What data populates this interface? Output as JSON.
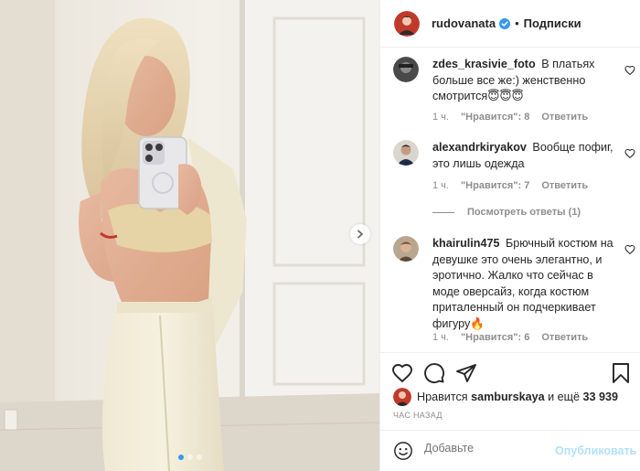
{
  "header": {
    "username": "rudovanata",
    "separator": "•",
    "follow_label": "Подписки"
  },
  "comments": [
    {
      "username": "zdes_krasivie_foto",
      "text": "В платьях больше все же:) женственно смотрится😇😇😇",
      "time": "1 ч.",
      "likes": "\"Нравится\": 8",
      "reply_label": "Ответить",
      "avatar_icon": "avatar-icon"
    },
    {
      "username": "alexandrkiryakov",
      "text": "Вообще пофиг, это лишь одежда",
      "time": "1 ч.",
      "likes": "\"Нравится\": 7",
      "reply_label": "Ответить",
      "avatar_icon": "avatar-icon",
      "view_replies": "Посмотреть ответы (1)"
    },
    {
      "username": "khairulin475",
      "text": "Брючный костюм на девушке это очень элегантно, и эротично. Жалко что сейчас в моде оверсайз, когда костюм приталенный он подчеркивает фигуру🔥",
      "time": "1 ч.",
      "likes": "\"Нравится\": 6",
      "reply_label": "Ответить",
      "avatar_icon": "avatar-icon"
    }
  ],
  "likes": {
    "prefix": "Нравится",
    "user": "samburskaya",
    "middle": "и ещё",
    "count": "33 939"
  },
  "time_ago": "ЧАС НАЗАД",
  "composer": {
    "placeholder": "Добавьте",
    "publish_label": "Опубликовать"
  },
  "carousel": {
    "total": 3,
    "active": 1
  },
  "colors": {
    "accent_blue": "#3897f0",
    "publish_disabled": "#b2dffc",
    "meta_gray": "#8e8e8e",
    "text": "#262626"
  },
  "icons": {
    "like": "heart-icon",
    "comment": "comment-icon",
    "share": "paper-plane-icon",
    "save": "bookmark-icon",
    "emoji": "smiley-icon",
    "next": "chevron-right-icon",
    "verified": "verified-badge-icon"
  }
}
